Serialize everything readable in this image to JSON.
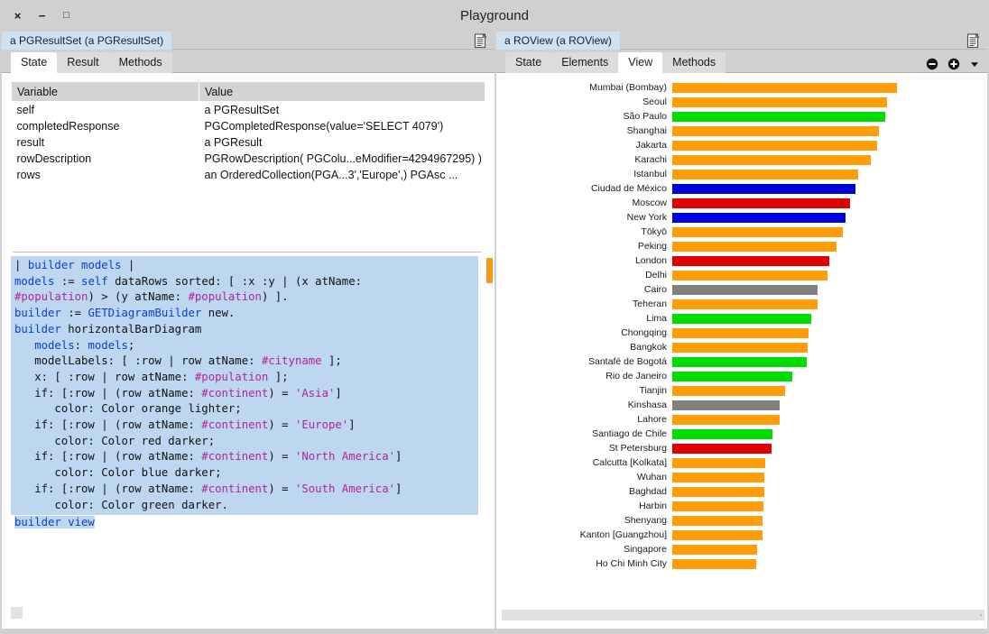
{
  "window": {
    "title": "Playground",
    "controls": [
      {
        "name": "close-button",
        "glyph": "×"
      },
      {
        "name": "minimize-button",
        "glyph": "−"
      },
      {
        "name": "maximize-button",
        "glyph": "□"
      }
    ]
  },
  "left_pane": {
    "object_title": "a PGResultSet (a PGResultSet)",
    "doc_icon": "document-icon",
    "tabs": [
      {
        "label": "State",
        "active": true
      },
      {
        "label": "Result",
        "active": false
      },
      {
        "label": "Methods",
        "active": false
      }
    ],
    "table": {
      "headers": [
        "Variable",
        "Value"
      ],
      "rows": [
        [
          "self",
          "a PGResultSet"
        ],
        [
          "completedResponse",
          "PGCompletedResponse(value='SELECT 4079')"
        ],
        [
          "result",
          "a PGResult"
        ],
        [
          "rowDescription",
          "PGRowDescription( PGColu...eModifier=4294967295) )"
        ],
        [
          "rows",
          "an OrderedCollection(PGA...3','Europe',) PGAsc ..."
        ]
      ]
    },
    "code": "| builder models |\nmodels := self dataRows sorted: [ :x :y | (x atName:\n#population) > (y atName: #population) ].\nbuilder := GETDiagramBuilder new.\nbuilder horizontalBarDiagram\n   models: models;\n   modelLabels: [ :row | row atName: #cityname ];\n   x: [ :row | row atName: #population ];\n   if: [:row | (row atName: #continent) = 'Asia']\n      color: Color orange lighter;\n   if: [:row | (row atName: #continent) = 'Europe']\n      color: Color red darker;\n   if: [:row | (row atName: #continent) = 'North America']\n      color: Color blue darker;\n   if: [:row | (row atName: #continent) = 'South America']\n      color: Color green darker.",
    "code_last_line": "builder view"
  },
  "right_pane": {
    "object_title": "a ROView (a ROView)",
    "doc_icon": "document-icon",
    "tabs": [
      {
        "label": "State",
        "active": false
      },
      {
        "label": "Elements",
        "active": false
      },
      {
        "label": "View",
        "active": true
      },
      {
        "label": "Methods",
        "active": false
      }
    ],
    "tools": [
      {
        "name": "zoom-out-icon",
        "label": "⊖"
      },
      {
        "name": "zoom-in-icon",
        "label": "⊕"
      },
      {
        "name": "dropdown-caret-icon",
        "label": "▾"
      }
    ]
  },
  "colors": {
    "asia_orange": "#FF9D0A",
    "europe_red": "#E00000",
    "north_america_blue": "#0000DD",
    "south_america_green": "#00DD00",
    "other_gray": "#808080",
    "code_background": "#BCD7EF",
    "chrome_gray": "#D0D0D0",
    "object_title_blue": "#CFE2F3"
  },
  "chart_data": {
    "type": "bar",
    "orientation": "horizontal",
    "title": "",
    "xlabel": "",
    "ylabel": "",
    "grid": false,
    "legend": null,
    "note": "Bar length encodes population; value is bar pixel width as rendered (max 249 px for Mumbai).",
    "categories": [
      "Mumbai (Bombay)",
      "Seoul",
      "São Paulo",
      "Shanghai",
      "Jakarta",
      "Karachi",
      "Istanbul",
      "Ciudad de México",
      "Moscow",
      "New York",
      "Tōkyō",
      "Peking",
      "London",
      "Delhi",
      "Cairo",
      "Teheran",
      "Lima",
      "Chongqing",
      "Bangkok",
      "Santafé de Bogotá",
      "Rio de Janeiro",
      "Tianjin",
      "Kinshasa",
      "Lahore",
      "Santiago de Chile",
      "St Petersburg",
      "Calcutta [Kolkata]",
      "Wuhan",
      "Baghdad",
      "Harbin",
      "Shenyang",
      "Kanton [Guangzhou]",
      "Singapore",
      "Ho Chi Minh City"
    ],
    "values": [
      249,
      238,
      236,
      229,
      227,
      220,
      206,
      203,
      197,
      192,
      189,
      182,
      174,
      172,
      161,
      161,
      154,
      151,
      150,
      149,
      133,
      125,
      119,
      119,
      111,
      110,
      103,
      102,
      102,
      101,
      100,
      100,
      94,
      93
    ],
    "continents": [
      "Asia",
      "Asia",
      "South America",
      "Asia",
      "Asia",
      "Asia",
      "Asia",
      "North America",
      "Europe",
      "North America",
      "Asia",
      "Asia",
      "Europe",
      "Asia",
      "Other",
      "Asia",
      "South America",
      "Asia",
      "Asia",
      "South America",
      "South America",
      "Asia",
      "Other",
      "Asia",
      "South America",
      "Europe",
      "Asia",
      "Asia",
      "Asia",
      "Asia",
      "Asia",
      "Asia",
      "Asia",
      "Asia"
    ],
    "bar_colors": [
      "#FF9D0A",
      "#FF9D0A",
      "#00DD00",
      "#FF9D0A",
      "#FF9D0A",
      "#FF9D0A",
      "#FF9D0A",
      "#0000DD",
      "#E00000",
      "#0000DD",
      "#FF9D0A",
      "#FF9D0A",
      "#E00000",
      "#FF9D0A",
      "#808080",
      "#FF9D0A",
      "#00DD00",
      "#FF9D0A",
      "#FF9D0A",
      "#00DD00",
      "#00DD00",
      "#FF9D0A",
      "#808080",
      "#FF9D0A",
      "#00DD00",
      "#E00000",
      "#FF9D0A",
      "#FF9D0A",
      "#FF9D0A",
      "#FF9D0A",
      "#FF9D0A",
      "#FF9D0A",
      "#FF9D0A",
      "#FF9D0A"
    ]
  }
}
